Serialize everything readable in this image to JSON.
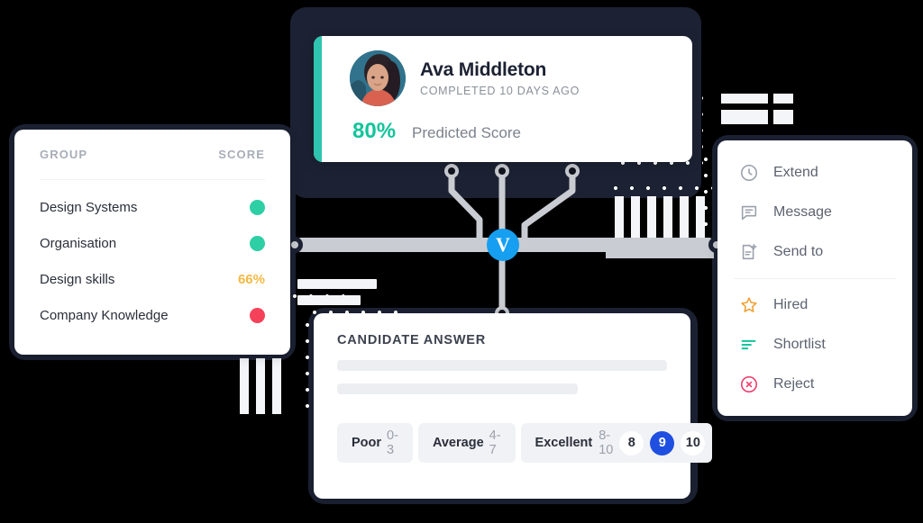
{
  "candidate": {
    "name": "Ava Middleton",
    "status": "COMPLETED 10 DAYS AGO",
    "score_pct": "80%",
    "score_label": "Predicted Score",
    "accent_color": "#2ec4b0",
    "score_color": "#12c49a"
  },
  "group_panel": {
    "header": {
      "group": "GROUP",
      "score": "SCORE"
    },
    "rows": [
      {
        "name": "Design Systems",
        "value_type": "dot",
        "value": "",
        "color": "#2ecfa5"
      },
      {
        "name": "Organisation",
        "value_type": "dot",
        "value": "",
        "color": "#2ecfa5"
      },
      {
        "name": "Design skills",
        "value_type": "text",
        "value": "66%",
        "color": "#f5b942"
      },
      {
        "name": "Company Knowledge",
        "value_type": "dot",
        "value": "",
        "color": "#f5425a"
      }
    ]
  },
  "action_menu": {
    "items": [
      {
        "label": "Extend",
        "icon": "clock-icon",
        "color": "#9aa0ab"
      },
      {
        "label": "Message",
        "icon": "chat-icon",
        "color": "#9aa0ab"
      },
      {
        "label": "Send to",
        "icon": "send-to-icon",
        "color": "#9aa0ab"
      }
    ],
    "items2": [
      {
        "label": "Hired",
        "icon": "star-icon",
        "color": "#f0a030"
      },
      {
        "label": "Shortlist",
        "icon": "shortlist-icon",
        "color": "#12c49a"
      },
      {
        "label": "Reject",
        "icon": "reject-icon",
        "color": "#ef3a6a"
      }
    ]
  },
  "answer_card": {
    "title": "CANDIDATE ANSWER",
    "rating": {
      "poor": {
        "label": "Poor",
        "range": "0-3"
      },
      "average": {
        "label": "Average",
        "range": "4-7"
      },
      "excellent": {
        "label": "Excellent",
        "range": "8-10"
      },
      "numbers": [
        "8",
        "9",
        "10"
      ],
      "selected": "9",
      "selected_color": "#1f4fe0"
    }
  },
  "badge": {
    "letter": "V",
    "color": "#169ff0"
  }
}
